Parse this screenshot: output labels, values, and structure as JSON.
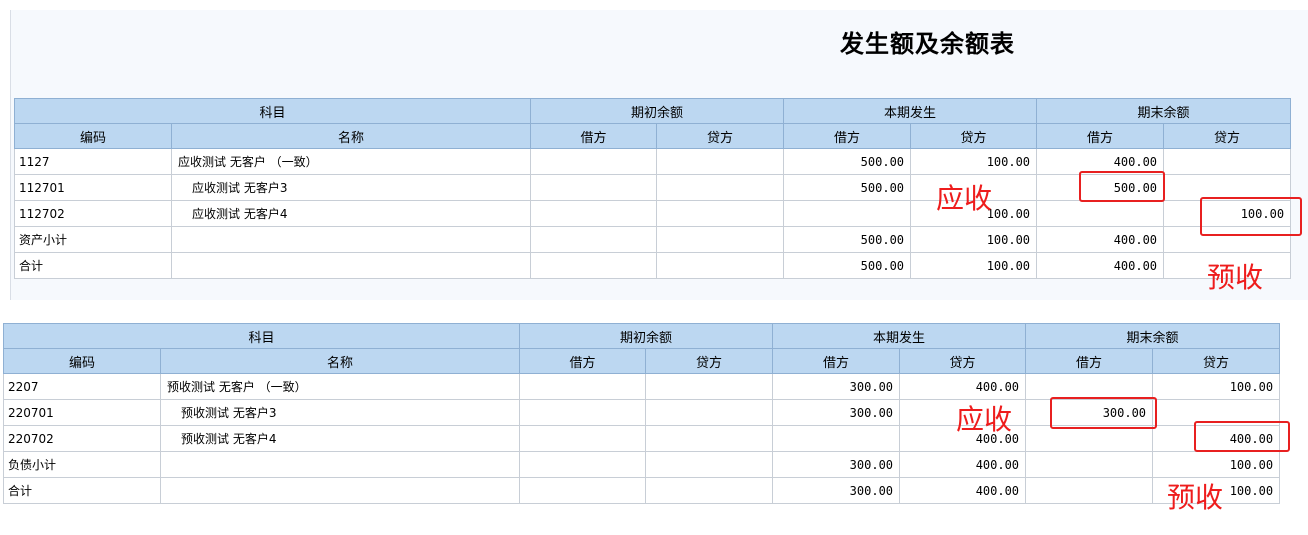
{
  "title": "发生额及余额表",
  "headers": {
    "group_subject": "科目",
    "group_opening": "期初余额",
    "group_current": "本期发生",
    "group_closing": "期末余额",
    "code": "编码",
    "name": "名称",
    "debit": "借方",
    "credit": "贷方"
  },
  "table1": {
    "rows": [
      {
        "code": "1127",
        "name": "应收测试 无客户 （一致）",
        "od": "",
        "oc": "",
        "cd": "500.00",
        "cc": "100.00",
        "ed": "400.00",
        "ec": ""
      },
      {
        "code": "112701",
        "name": "应收测试 无客户3",
        "od": "",
        "oc": "",
        "cd": "500.00",
        "cc": "",
        "ed": "500.00",
        "ec": ""
      },
      {
        "code": "112702",
        "name": "应收测试 无客户4",
        "od": "",
        "oc": "",
        "cd": "",
        "cc": "100.00",
        "ed": "",
        "ec": "100.00"
      },
      {
        "code": "资产小计",
        "name": "",
        "od": "",
        "oc": "",
        "cd": "500.00",
        "cc": "100.00",
        "ed": "400.00",
        "ec": ""
      },
      {
        "code": "合计",
        "name": "",
        "od": "",
        "oc": "",
        "cd": "500.00",
        "cc": "100.00",
        "ed": "400.00",
        "ec": ""
      }
    ]
  },
  "table2": {
    "rows": [
      {
        "code": "2207",
        "name": "预收测试 无客户 （一致）",
        "od": "",
        "oc": "",
        "cd": "300.00",
        "cc": "400.00",
        "ed": "",
        "ec": "100.00"
      },
      {
        "code": "220701",
        "name": "预收测试 无客户3",
        "od": "",
        "oc": "",
        "cd": "300.00",
        "cc": "",
        "ed": "300.00",
        "ec": ""
      },
      {
        "code": "220702",
        "name": "预收测试 无客户4",
        "od": "",
        "oc": "",
        "cd": "",
        "cc": "400.00",
        "ed": "",
        "ec": "400.00"
      },
      {
        "code": "负债小计",
        "name": "",
        "od": "",
        "oc": "",
        "cd": "300.00",
        "cc": "400.00",
        "ed": "",
        "ec": "100.00"
      },
      {
        "code": "合计",
        "name": "",
        "od": "",
        "oc": "",
        "cd": "300.00",
        "cc": "400.00",
        "ed": "",
        "ec": "100.00"
      }
    ]
  },
  "annotations": {
    "receivable": "应收",
    "advance": "预收",
    "color": "#ee1c1c"
  }
}
